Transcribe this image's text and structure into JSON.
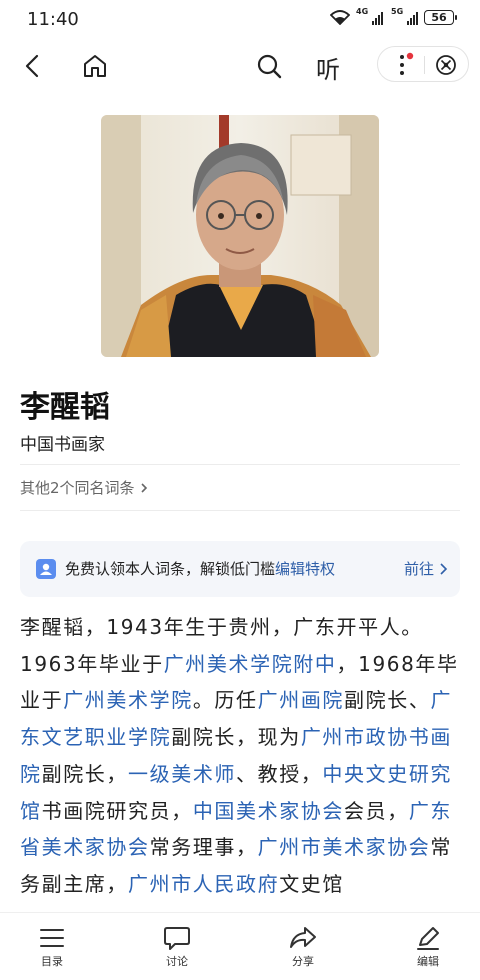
{
  "status_bar": {
    "time": "11:40",
    "network_1": "4G",
    "network_2": "5G",
    "battery": "56"
  },
  "nav": {
    "listen_label": "听"
  },
  "entry": {
    "title": "李醒韬",
    "subtitle": "中国书画家",
    "others_link": "其他2个同名词条"
  },
  "claim_banner": {
    "text": "免费认领本人词条，解锁低门槛",
    "link": "编辑特权",
    "action": "前往"
  },
  "paragraph": [
    {
      "t": "李醒韬，1943年生于贵州，广东开平人。1963年毕业于"
    },
    {
      "l": "广州美术学院附中"
    },
    {
      "t": "，1968年毕业于"
    },
    {
      "l": "广州美术学院"
    },
    {
      "t": "。历任"
    },
    {
      "l": "广州画院"
    },
    {
      "t": "副院长、"
    },
    {
      "l": "广东文艺职业学院"
    },
    {
      "t": "副院长，现为"
    },
    {
      "l": "广州市政协书画院"
    },
    {
      "t": "副院长，"
    },
    {
      "l": "一级美术师"
    },
    {
      "t": "、教授，"
    },
    {
      "l": "中央文史研究馆"
    },
    {
      "t": "书画院研究员，"
    },
    {
      "l": "中国美术家协会"
    },
    {
      "t": "会员，"
    },
    {
      "l": "广东省美术家协会"
    },
    {
      "t": "常务理事，"
    },
    {
      "l": "广州市美术家协会"
    },
    {
      "t": "常务副主席，"
    },
    {
      "l": "广州市人民政府"
    },
    {
      "t": "文史馆"
    }
  ],
  "bottom_bar": {
    "toc": "目录",
    "discuss": "讨论",
    "share": "分享",
    "edit": "编辑"
  }
}
